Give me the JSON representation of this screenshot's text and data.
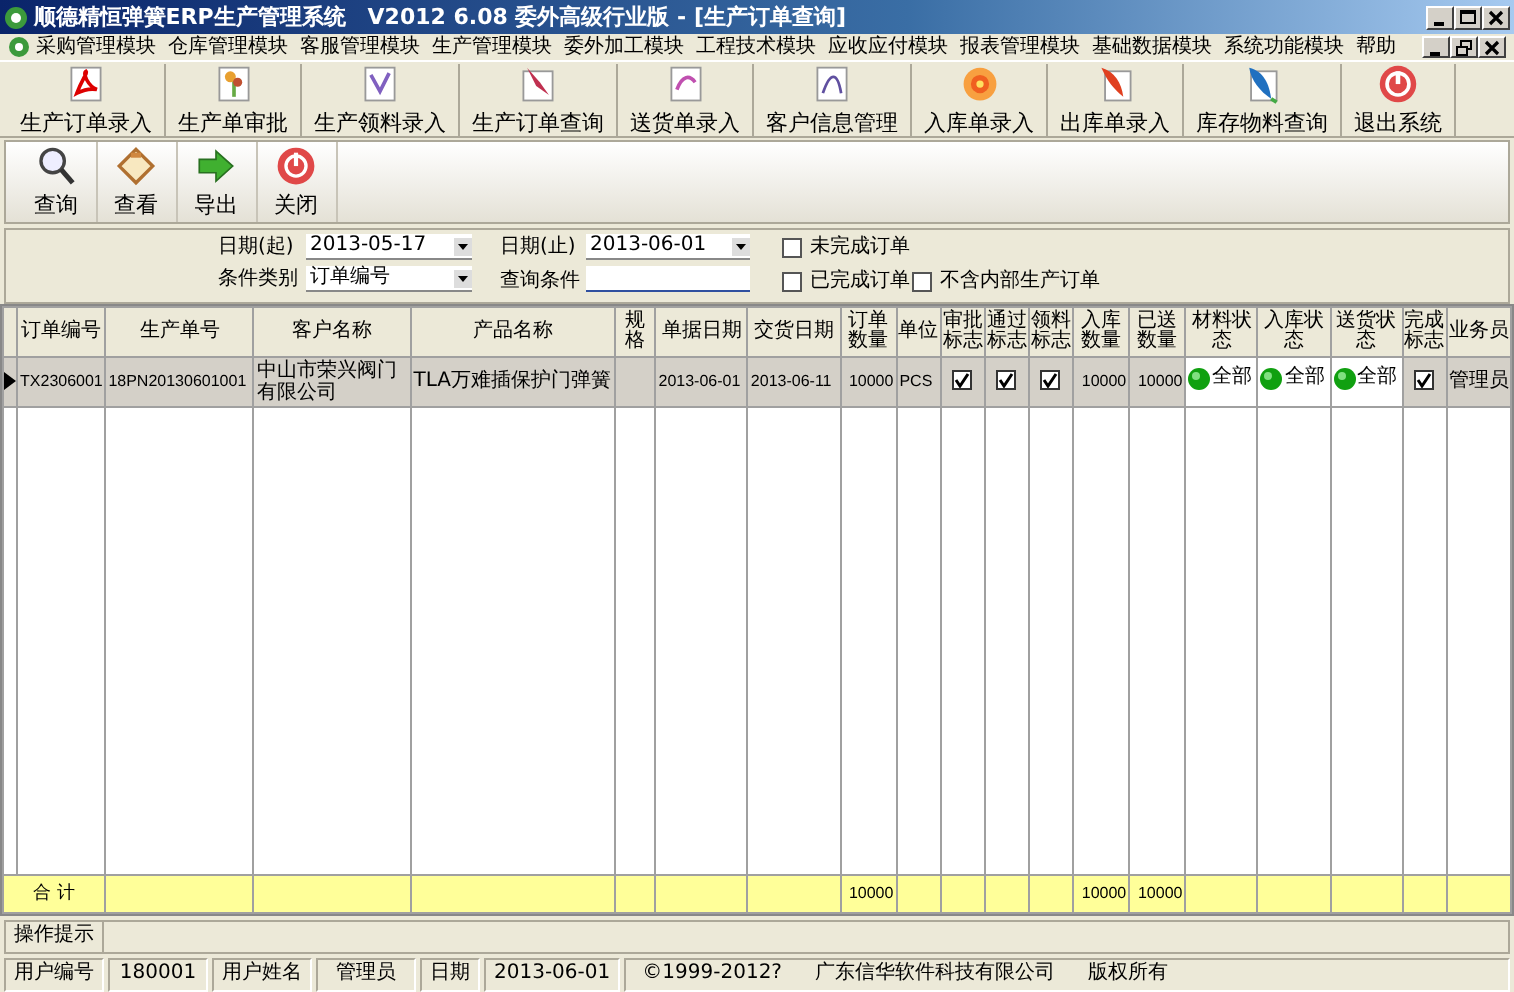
{
  "window": {
    "title": "顺德精恒弹簧ERP生产管理系统　V2012 6.08 委外高级行业版 - [生产订单查询]"
  },
  "menu": [
    "采购管理模块",
    "仓库管理模块",
    "客服管理模块",
    "生产管理模块",
    "委外加工模块",
    "工程技术模块",
    "应收应付模块",
    "报表管理模块",
    "基础数据模块",
    "系统功能模块",
    "帮助"
  ],
  "toolbar": [
    "生产订单录入",
    "生产单审批",
    "生产领料录入",
    "生产订单查询",
    "送货单录入",
    "客户信息管理",
    "入库单录入",
    "出库单录入",
    "库存物料查询",
    "退出系统"
  ],
  "actions": [
    "查询",
    "查看",
    "导出",
    "关闭"
  ],
  "filters": {
    "date_from": {
      "label": "日期(起)",
      "value": "2013-05-17"
    },
    "date_to": {
      "label": "日期(止)",
      "value": "2013-06-01"
    },
    "condition_type": {
      "label": "条件类别",
      "value": "订单编号"
    },
    "query": {
      "label": "查询条件"
    },
    "options": [
      {
        "label": "未完成订单",
        "checked": false
      },
      {
        "label": "已完成订单",
        "checked": false
      },
      {
        "label": "不含内部生产订单",
        "checked": false
      }
    ]
  },
  "table": {
    "columns": [
      "订单编号",
      "生产单号",
      "客户名称",
      "产品名称",
      "规格",
      "单据日期",
      "交货日期",
      "订单数量",
      "单位",
      "审批标志",
      "通过标志",
      "领料标志",
      "入库数量",
      "已送数量",
      "材料状态",
      "入库状态",
      "送货状态",
      "完成标志",
      "业务员"
    ],
    "rows": [
      {
        "selected": true,
        "cells": [
          {
            "kind": "text",
            "text": "TX2306001"
          },
          {
            "kind": "text",
            "text": "18PN20130601001"
          },
          {
            "kind": "text",
            "text": "中山市荣兴阀门有限公司"
          },
          {
            "kind": "text",
            "text": "TLA万难插保护门弹簧"
          },
          {
            "kind": "text"
          },
          {
            "kind": "text",
            "text": "2013-06-01"
          },
          {
            "kind": "text",
            "text": "2013-06-11"
          },
          {
            "kind": "number",
            "text": "10000"
          },
          {
            "kind": "text",
            "text": "PCS"
          },
          {
            "kind": "check",
            "checked": true
          },
          {
            "kind": "check",
            "checked": true
          },
          {
            "kind": "check",
            "checked": true
          },
          {
            "kind": "number",
            "text": "10000"
          },
          {
            "kind": "number",
            "text": "10000"
          },
          {
            "kind": "status",
            "text": "全部"
          },
          {
            "kind": "status",
            "text": "全部"
          },
          {
            "kind": "status",
            "text": "全部"
          },
          {
            "kind": "check",
            "checked": true
          },
          {
            "kind": "text",
            "text": "管理员"
          }
        ]
      }
    ],
    "totals": {
      "label": "合 计",
      "order_qty": "10000",
      "in_qty": "10000",
      "sent_qty": "10000"
    }
  },
  "hint": {
    "label": "操作提示"
  },
  "status_bar": {
    "fields": [
      {
        "label": "用户编号",
        "value": "180001"
      },
      {
        "label": "用户姓名",
        "value": "管理员"
      },
      {
        "label": "日期",
        "value": "2013-06-01"
      }
    ],
    "copyright": "©1999-2012?",
    "company": "广东信华软件科技有限公司",
    "rights": "版权所有"
  }
}
